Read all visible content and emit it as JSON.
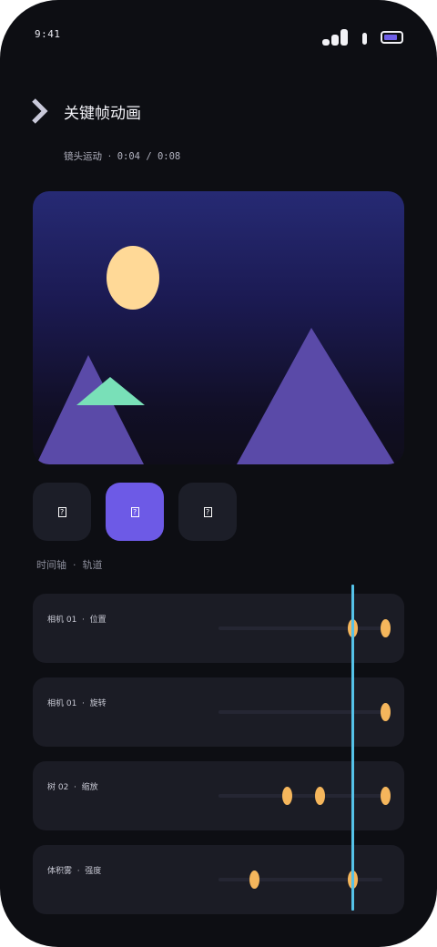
{
  "status_bar": {
    "time": "9:41",
    "battery_level": 0.85
  },
  "header": {
    "back_icon": "chevron-right-icon",
    "title": "关键帧动画",
    "subtitle_name": "镜头运动",
    "subtitle_sep": "·",
    "subtitle_time": "0:04 / 0:08"
  },
  "preview": {
    "scene": "night-landscape",
    "colors": {
      "sky_top": "#262a74",
      "moon": "#ffd997",
      "mountain": "#5a4aa8",
      "tree": "#79e0b8"
    }
  },
  "tools": [
    {
      "id": "tool-1",
      "icon": "?",
      "active": false
    },
    {
      "id": "tool-2",
      "icon": "?",
      "active": true
    },
    {
      "id": "tool-3",
      "icon": "?",
      "active": false
    }
  ],
  "timeline": {
    "label": "时间轴  ·  轨道",
    "playhead_position": 0.82,
    "tracks": [
      {
        "label": "相机 01  ·  位置",
        "keyframes": [
          0.82,
          1.02
        ]
      },
      {
        "label": "相机 01  ·  旋转",
        "keyframes": [
          1.02
        ]
      },
      {
        "label": "树 02  ·  缩放",
        "keyframes": [
          0.42,
          0.62,
          1.02
        ]
      },
      {
        "label": "体积雾  ·  强度",
        "keyframes": [
          0.22,
          0.82
        ]
      }
    ]
  },
  "colors": {
    "accent": "#6d5ae6",
    "keyframe": "#f5b65c",
    "playhead": "#55c2e8",
    "background": "#0d0e13"
  }
}
